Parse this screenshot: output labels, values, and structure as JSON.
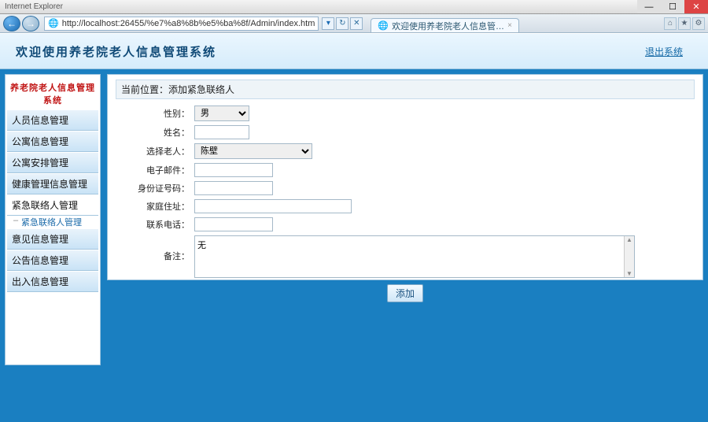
{
  "chrome": {
    "title_hint": "Internet Explorer",
    "min": "—",
    "max": "☐",
    "close": "✕"
  },
  "addr": {
    "url": "http://localhost:26455/%e7%a8%8b%e5%ba%8f/Admin/index.htm",
    "refresh": "↻",
    "stop": "✕",
    "tab_label": "欢迎使用养老院老人信息管…",
    "tab_close": "×"
  },
  "tools": {
    "home": "⌂",
    "fav": "★",
    "gear": "⚙"
  },
  "header": {
    "title": "欢迎使用养老院老人信息管理系统",
    "logout": "退出系统"
  },
  "sidebar": {
    "header": "养老院老人信息管理系统",
    "m0": "人员信息管理",
    "m1": "公寓信息管理",
    "m2": "公寓安排管理",
    "m3": "健康管理信息管理",
    "m4": "紧急联络人管理",
    "m4s": "紧急联络人管理",
    "m5": "意见信息管理",
    "m6": "公告信息管理",
    "m7": "出入信息管理"
  },
  "breadcrumb": "当前位置：添加紧急联络人",
  "form": {
    "gender_label": "性别：",
    "gender_val": "男",
    "name_label": "姓名：",
    "name_val": "",
    "elder_label": "选择老人：",
    "elder_val": "陈壁",
    "email_label": "电子邮件：",
    "email_val": "",
    "idno_label": "身份证号码：",
    "idno_val": "",
    "addr_label": "家庭住址：",
    "addr_val": "",
    "phone_label": "联系电话：",
    "phone_val": "",
    "remark_label": "备注：",
    "remark_val": "无",
    "submit": "添加"
  }
}
